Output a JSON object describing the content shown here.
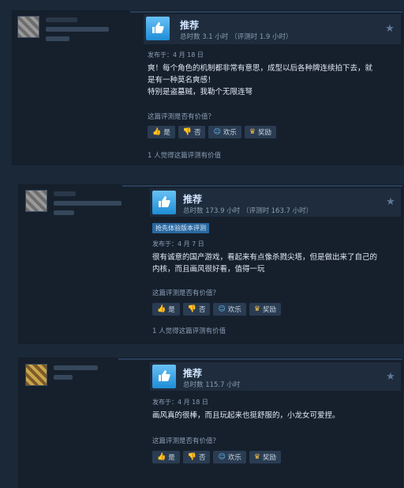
{
  "reviews": [
    {
      "verdict": "推荐",
      "hours": "总时数 3.1 小时 （评测时 1.9 小时）",
      "badge": "",
      "date": "发布于：4 月 18 日",
      "body_lines": [
        "爽！每个角色的机制都非常有意思，成型以后各种牌连续拍下去，就",
        "是有一种莫名爽感！",
        "特别是盗墓贼，我勒个无限连弩"
      ],
      "question": "这篇评测是否有价值？",
      "buttons": {
        "yes": "是",
        "no": "否",
        "funny": "欢乐",
        "award": "奖励"
      },
      "helpful": "1 人觉得这篇评测有价值"
    },
    {
      "verdict": "推荐",
      "hours": "总时数 173.9 小时 （评测时 163.7 小时）",
      "badge": "抢先体验版本评测",
      "date": "发布于：4 月 7 日",
      "body_lines": [
        "很有诚意的国产游戏，看起来有点像杀戮尖塔，但是做出来了自己的",
        "内核，而且画风很好看，值得一玩"
      ],
      "question": "这篇评测是否有价值？",
      "buttons": {
        "yes": "是",
        "no": "否",
        "funny": "欢乐",
        "award": "奖励"
      },
      "helpful": "1 人觉得这篇评测有价值"
    },
    {
      "verdict": "推荐",
      "hours": "总时数 115.7 小时",
      "badge": "",
      "date": "发布于：4 月 18 日",
      "body_lines": [
        "画风真的很棒，而且玩起来也挺舒服的，小龙女可爱捏。"
      ],
      "question": "这篇评测是否有价值？",
      "buttons": {
        "yes": "是",
        "no": "否",
        "funny": "欢乐",
        "award": "奖励"
      },
      "helpful": ""
    }
  ],
  "colors": {
    "accent": "#66c0f4",
    "award": "#f5c04a",
    "background": "#1b2838"
  },
  "icons": {
    "thumb": "thumbs-up-icon",
    "star": "star-icon"
  }
}
